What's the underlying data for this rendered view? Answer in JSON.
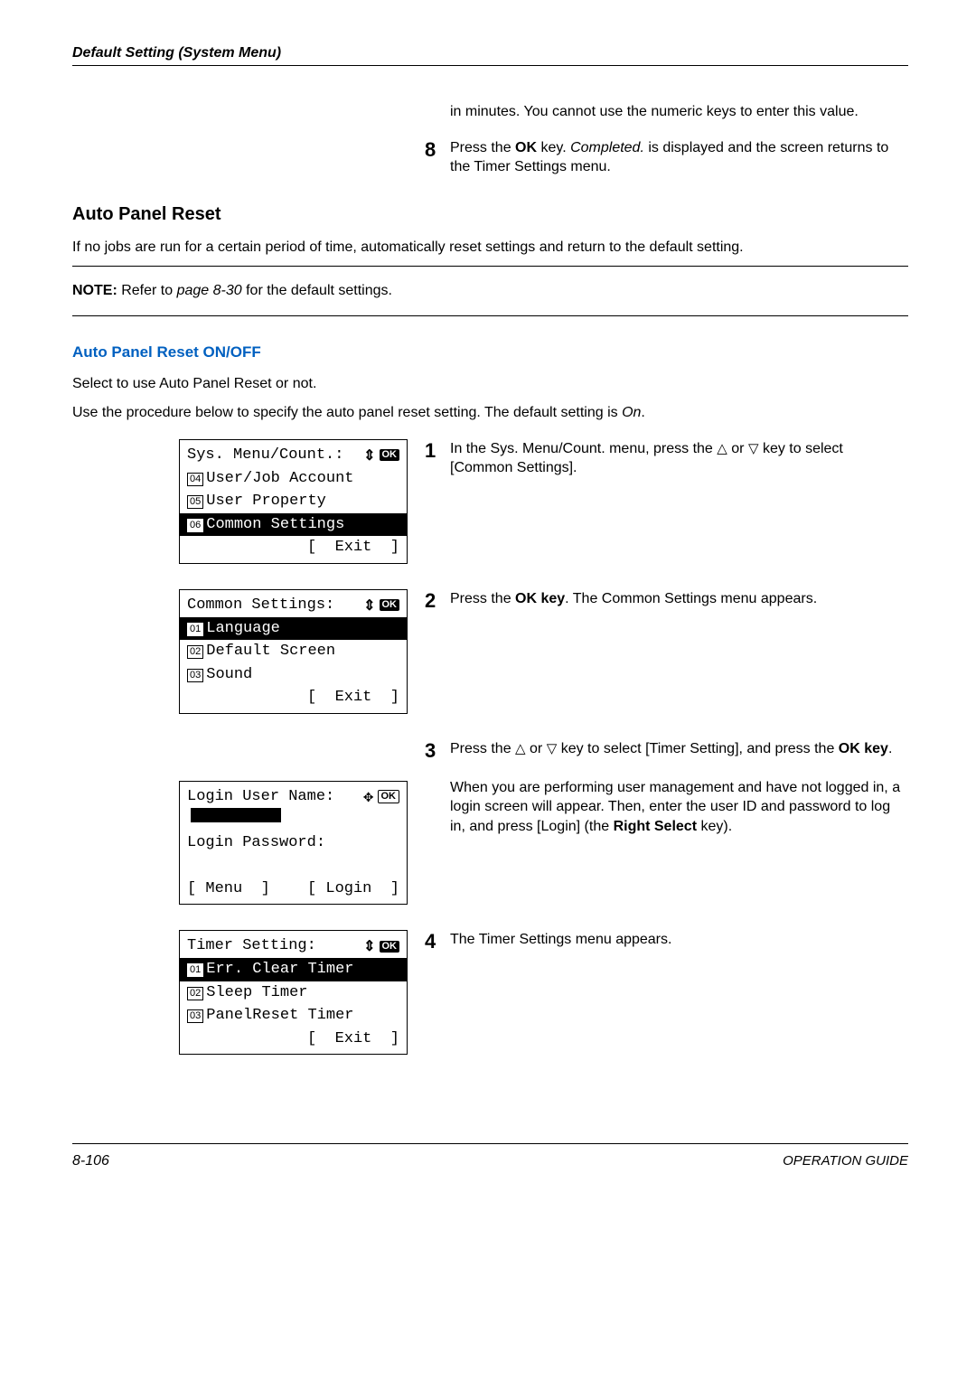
{
  "header": {
    "title": "Default Setting (System Menu)"
  },
  "intro_tail": "in minutes. You cannot use the numeric keys to enter this value.",
  "step8": {
    "num": "8",
    "pre": "Press the ",
    "ok": "OK",
    "mid": " key. ",
    "completed": "Completed.",
    "post": " is displayed and the screen returns to the Timer Settings menu."
  },
  "section_title": "Auto Panel Reset",
  "section_desc": "If no jobs are run for a certain period of time, automatically reset settings and return to the default setting.",
  "note": {
    "label": "NOTE:",
    "pre": " Refer to ",
    "ref": "page 8-30",
    "post": " for the default settings."
  },
  "sub_title": "Auto Panel Reset ON/OFF",
  "sub_p1": "Select to use Auto Panel Reset or not.",
  "sub_p2_pre": "Use the procedure below to specify the auto panel reset setting. The default setting is ",
  "sub_p2_em": "On",
  "sub_p2_post": ".",
  "screen1": {
    "title": "Sys. Menu/Count.:",
    "items": [
      {
        "n": "04",
        "label": "User/Job Account"
      },
      {
        "n": "05",
        "label": "User Property"
      },
      {
        "n": "06",
        "label": "Common Settings"
      }
    ],
    "exit": "[  Exit  ]",
    "hl_index": 2
  },
  "screen2": {
    "title": "Common Settings:",
    "items": [
      {
        "n": "01",
        "label": "Language"
      },
      {
        "n": "02",
        "label": "Default Screen"
      },
      {
        "n": "03",
        "label": "Sound"
      }
    ],
    "exit": "[  Exit  ]",
    "hl_index": 0
  },
  "screen3": {
    "line1": "Login User Name:",
    "line2": "Login Password:",
    "left_btn": "[ Menu  ]",
    "right_btn": "[ Login  ]"
  },
  "screen4": {
    "title": "Timer Setting:",
    "items": [
      {
        "n": "01",
        "label": "Err. Clear Timer"
      },
      {
        "n": "02",
        "label": "Sleep Timer"
      },
      {
        "n": "03",
        "label": "PanelReset Timer"
      }
    ],
    "exit": "[  Exit  ]",
    "hl_index": 0
  },
  "step1": {
    "num": "1",
    "a": "In the ",
    "b": "Sys. Menu/Count.",
    "c": " menu, press the ",
    "d": " or ",
    "e": " key to select [Common Settings]."
  },
  "step2": {
    "num": "2",
    "a": "Press the ",
    "b": "OK",
    "c": " key",
    "d": ". The Common Settings menu appears."
  },
  "step3": {
    "num": "3",
    "a": "Press the ",
    "b": " or ",
    "c": " key to select [Timer Setting], and press the ",
    "d": "OK",
    "e": " key",
    "para2a": "When you are performing user management and have not logged in, a login screen will appear. Then, enter the user ID and password to log in, and press [Login] (the ",
    "para2b": "Right Select",
    "para2c": " key)."
  },
  "step4": {
    "num": "4",
    "text": "The Timer Settings menu appears."
  },
  "footer": {
    "left": "8-106",
    "right": "OPERATION GUIDE"
  },
  "ok_badge": "OK"
}
